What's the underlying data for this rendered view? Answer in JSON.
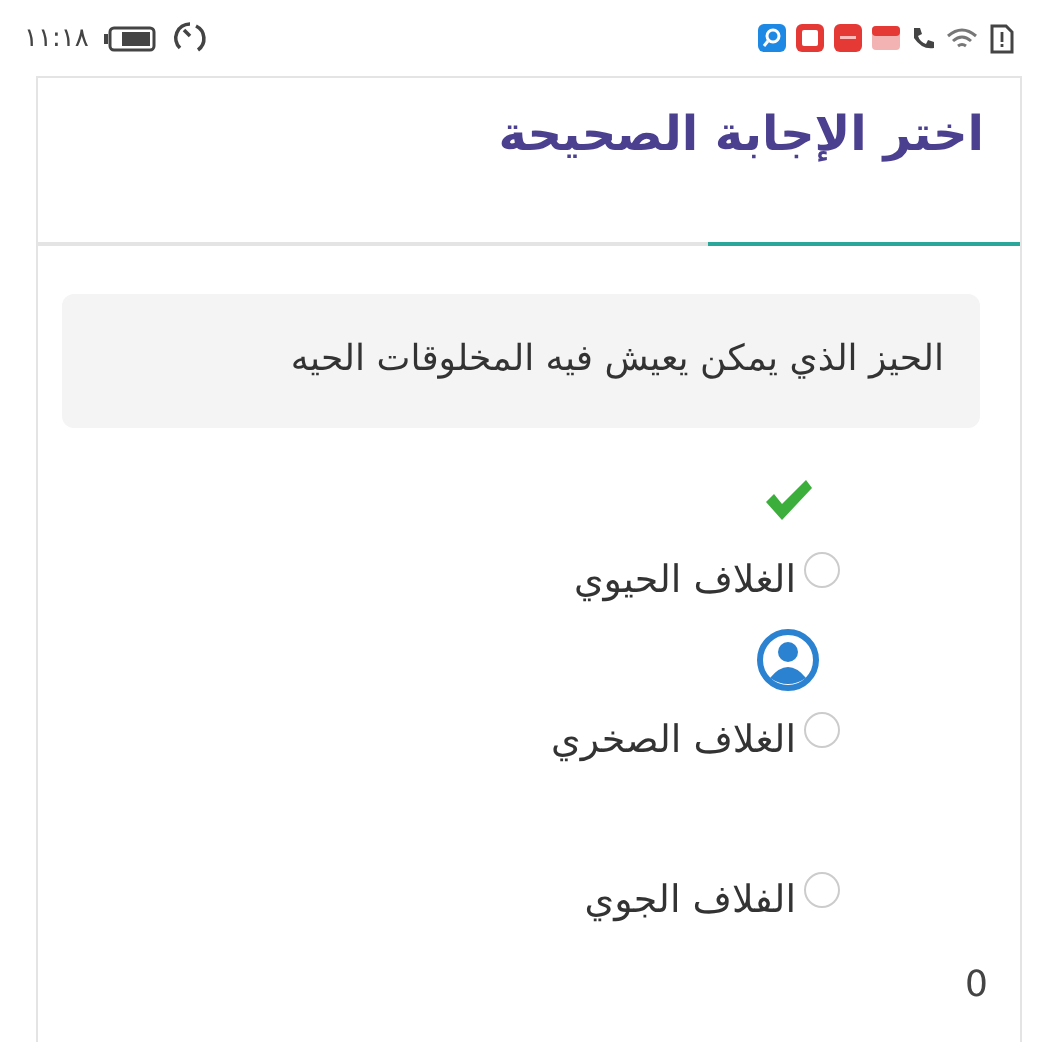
{
  "status_bar": {
    "time": "١١:١٨"
  },
  "title": "اختر الإجابة الصحيحة",
  "question": "الحيز الذي يمكن يعيش فيه المخلوقات الحيه",
  "options": [
    {
      "label": "الغلاف الحيوي",
      "selected": false,
      "correct": true,
      "chosen": false
    },
    {
      "label": "الغلاف الصخري",
      "selected": false,
      "correct": false,
      "chosen": true
    },
    {
      "label": "الفلاف الجوي",
      "selected": false,
      "correct": false,
      "chosen": false
    }
  ],
  "score": "0"
}
